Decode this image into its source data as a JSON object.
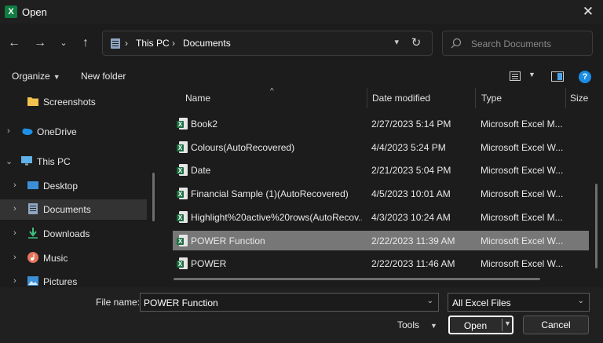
{
  "window": {
    "title": "Open",
    "app_icon": "excel-icon",
    "close_icon": "close-icon"
  },
  "nav": {
    "back_icon": "arrow-left-icon",
    "forward_icon": "arrow-right-icon",
    "recent_icon": "chevron-down-icon",
    "up_icon": "arrow-up-icon",
    "breadcrumb": [
      "This PC",
      "Documents"
    ],
    "search_placeholder": "Search Documents"
  },
  "toolbar": {
    "organize": "Organize",
    "new_folder": "New folder"
  },
  "sidebar": {
    "items": [
      {
        "label": "Screenshots",
        "icon": "folder-icon",
        "expandable": false,
        "expanded": false,
        "selected": false
      },
      {
        "label": "OneDrive",
        "icon": "cloud-icon",
        "expandable": true,
        "expanded": false,
        "selected": false
      },
      {
        "label": "This PC",
        "icon": "computer-icon",
        "expandable": true,
        "expanded": true,
        "selected": false
      },
      {
        "label": "Desktop",
        "icon": "desktop-icon",
        "expandable": true,
        "expanded": false,
        "selected": false
      },
      {
        "label": "Documents",
        "icon": "documents-icon",
        "expandable": true,
        "expanded": false,
        "selected": true
      },
      {
        "label": "Downloads",
        "icon": "download-icon",
        "expandable": true,
        "expanded": false,
        "selected": false
      },
      {
        "label": "Music",
        "icon": "music-icon",
        "expandable": true,
        "expanded": false,
        "selected": false
      },
      {
        "label": "Pictures",
        "icon": "pictures-icon",
        "expandable": true,
        "expanded": false,
        "selected": false
      }
    ]
  },
  "filelist": {
    "columns": {
      "name": "Name",
      "date": "Date modified",
      "type": "Type",
      "size": "Size"
    },
    "rows": [
      {
        "name": "Book2",
        "date": "2/27/2023 5:14 PM",
        "type": "Microsoft Excel M...",
        "selected": false
      },
      {
        "name": "Colours(AutoRecovered)",
        "date": "4/4/2023 5:24 PM",
        "type": "Microsoft Excel W...",
        "selected": false
      },
      {
        "name": "Date",
        "date": "2/21/2023 5:04 PM",
        "type": "Microsoft Excel W...",
        "selected": false
      },
      {
        "name": "Financial Sample (1)(AutoRecovered)",
        "date": "4/5/2023 10:01 AM",
        "type": "Microsoft Excel W...",
        "selected": false
      },
      {
        "name": "Highlight%20active%20rows(AutoRecov...",
        "date": "4/3/2023 10:24 AM",
        "type": "Microsoft Excel M...",
        "selected": false
      },
      {
        "name": "POWER Function",
        "date": "2/22/2023 11:39 AM",
        "type": "Microsoft Excel W...",
        "selected": true
      },
      {
        "name": "POWER",
        "date": "2/22/2023 11:46 AM",
        "type": "Microsoft Excel W...",
        "selected": false
      }
    ]
  },
  "footer": {
    "file_name_label": "File name:",
    "file_name_value": "POWER Function",
    "filter": "All Excel Files",
    "tools": "Tools",
    "open": "Open",
    "cancel": "Cancel"
  },
  "colors": {
    "selected_row": "#777777",
    "sidebar_selected": "#333333",
    "excel_green": "#1d6f42",
    "help_blue": "#1a8de3"
  }
}
